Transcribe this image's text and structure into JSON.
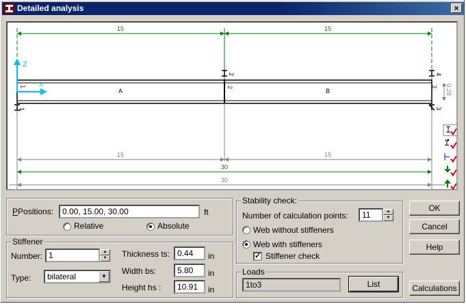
{
  "window": {
    "title": "Detailed analysis",
    "close_label": "×"
  },
  "diagram": {
    "top_spans": [
      "15",
      "15"
    ],
    "bottom_spans": [
      "15",
      "15"
    ],
    "total_green": "30",
    "total_grey": "30",
    "segments": [
      "A",
      "B"
    ],
    "support_labels_top": [
      "2",
      "4"
    ],
    "support_labels_bottom": [
      "1",
      "3"
    ],
    "node_labels_red": [
      "1",
      "2",
      "3"
    ],
    "height_dim": "0.28",
    "axis_z": "Z",
    "axis_x": "X"
  },
  "positions": {
    "label": "Positions:",
    "value": "0.00, 15.00, 30.00",
    "unit": "ft",
    "relative_label": "Relative",
    "absolute_label": "Absolute",
    "mode": "absolute"
  },
  "stiffener": {
    "legend": "Stiffener",
    "number_label": "Number:",
    "number_value": "1",
    "type_label": "Type:",
    "type_value": "bilateral",
    "thickness_label": "Thickness ts:",
    "thickness_value": "0.44",
    "thickness_unit": "in",
    "width_label": "Width bs:",
    "width_value": "5.80",
    "width_unit": "in",
    "height_label": "Height hs :",
    "height_value": "10.91",
    "height_unit": "in"
  },
  "stability": {
    "legend": "Stability check:",
    "calc_points_label": "Number of calculation points:",
    "calc_points_value": "11",
    "without_label": "Web without stiffeners",
    "with_label": "Web with stiffeners",
    "selected": "with",
    "stiffener_check_label": "Stiffener check",
    "stiffener_check": true
  },
  "loads": {
    "legend": "Loads",
    "value": "1to3",
    "list_label": "List"
  },
  "buttons": {
    "ok": "OK",
    "cancel": "Cancel",
    "help": "Help",
    "calculations": "Calculations"
  },
  "toolbar_icons": [
    "support-top-icon",
    "support-bottom-icon",
    "stiffener-left-icon",
    "load-down-icon",
    "load-up-icon"
  ],
  "colors": {
    "dim_green": "#008000",
    "dim_grey": "#808080",
    "node_red": "#c00000",
    "axis_cyan": "#00c0ff",
    "check_red": "#e00000"
  }
}
